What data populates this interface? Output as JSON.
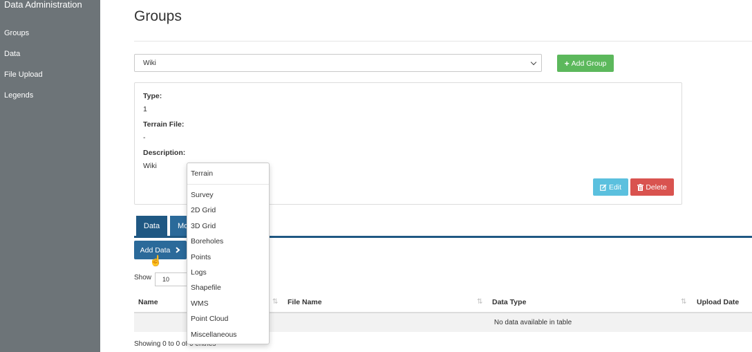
{
  "sidebar": {
    "title": "Data Administration",
    "items": [
      {
        "label": "Groups"
      },
      {
        "label": "Data"
      },
      {
        "label": "File Upload"
      },
      {
        "label": "Legends"
      }
    ]
  },
  "page": {
    "title": "Groups",
    "group_select_value": "Wiki",
    "add_group_label": "Add Group"
  },
  "details": {
    "type_label": "Type:",
    "type_value": "1",
    "terrain_label": "Terrain File:",
    "terrain_value": "-",
    "description_label": "Description:",
    "description_value": "Wiki",
    "edit_label": "Edit",
    "delete_label": "Delete"
  },
  "tabs": [
    {
      "label": "Data"
    },
    {
      "label": "Mo"
    }
  ],
  "toolbar": {
    "add_data_label": "Add Data"
  },
  "table": {
    "show_label": "Show",
    "length_value": "10",
    "columns": [
      "Name",
      "File Name",
      "Data Type",
      "Upload Date"
    ],
    "empty_message": "No data available in table",
    "info_text": "Showing 0 to 0 of 0 entries"
  },
  "dropdown": {
    "items": [
      "Terrain",
      "Survey",
      "2D Grid",
      "3D Grid",
      "Boreholes",
      "Points",
      "Logs",
      "Shapefile",
      "WMS",
      "Point Cloud",
      "Miscellaneous"
    ]
  },
  "colors": {
    "sidebar": "#6d7478",
    "success": "#5cb85c",
    "info": "#5bc0de",
    "danger": "#d9534f",
    "primary_dark": "#1f5883"
  },
  "icons": {
    "add_group": "plus-icon",
    "edit": "edit-icon",
    "delete": "trash-icon",
    "add_data": "chevron-right-icon",
    "cursor": "hand-pointer-icon",
    "sort": "sort-icon"
  }
}
